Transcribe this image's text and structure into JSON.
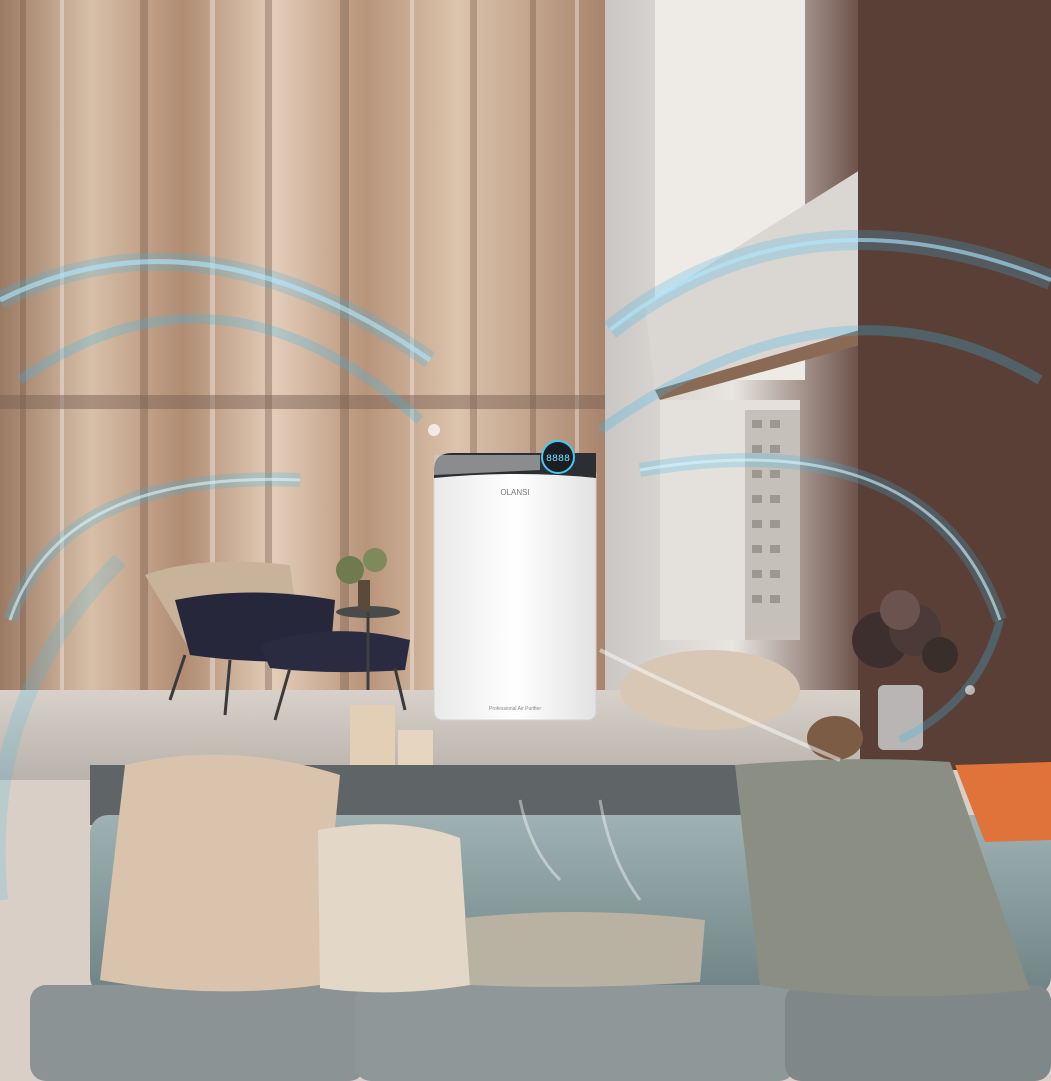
{
  "product": {
    "brand": "OLANSI",
    "model_text": "Professional Air Purifier",
    "display_readout": "8888"
  },
  "colors": {
    "airflow": "#3fb8e8",
    "curtain": "#c7a990",
    "sofa": "#8fa3a6",
    "purifier_body": "#f7f7f7",
    "purifier_top": "#2b2f33",
    "orange_pillow": "#e0733a"
  }
}
